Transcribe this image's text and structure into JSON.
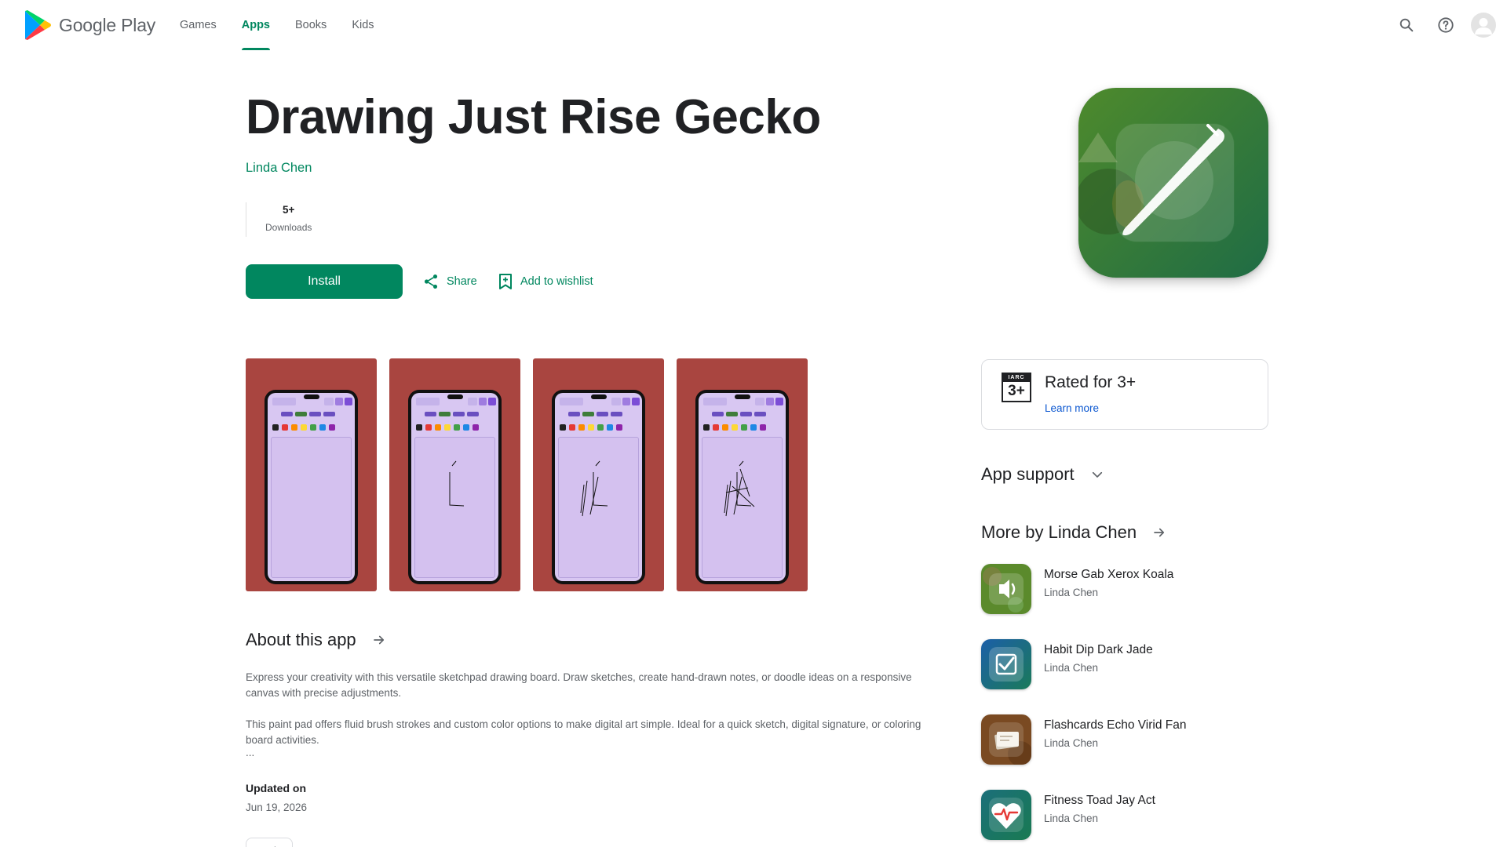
{
  "header": {
    "brand": "Google Play",
    "tabs": [
      {
        "label": "Games",
        "active": false
      },
      {
        "label": "Apps",
        "active": true
      },
      {
        "label": "Books",
        "active": false
      },
      {
        "label": "Kids",
        "active": false
      }
    ],
    "icons": [
      "search-icon",
      "help-icon",
      "account-icon"
    ]
  },
  "app": {
    "title": "Drawing Just Rise Gecko",
    "developer": "Linda Chen",
    "downloads_value": "5+",
    "downloads_label": "Downloads",
    "install_label": "Install",
    "share_label": "Share",
    "wishlist_label": "Add to wishlist"
  },
  "screenshots": [
    {
      "strokes": 0
    },
    {
      "strokes": 2
    },
    {
      "strokes": 5
    },
    {
      "strokes": 8
    }
  ],
  "about": {
    "heading": "About this app",
    "paragraph1": "Express your creativity with this versatile sketchpad drawing board. Draw sketches, create hand-drawn notes, or doodle ideas on a responsive canvas with precise adjustments.",
    "paragraph2": "This paint pad offers fluid brush strokes and custom color options to make digital art simple. Ideal for a quick sketch, digital signature, or coloring board activities.",
    "ellipsis": "...",
    "updated_label": "Updated on",
    "updated_value": "Jun 19, 2026",
    "tag": "Tools"
  },
  "rating": {
    "badge_top": "IARC",
    "badge_value": "3+",
    "title": "Rated for 3+",
    "learn_more": "Learn more"
  },
  "support": {
    "heading": "App support"
  },
  "more_by": {
    "heading": "More by Linda Chen",
    "items": [
      {
        "name": "Morse Gab Xerox Koala",
        "developer": "Linda Chen",
        "icon": "speaker-icon"
      },
      {
        "name": "Habit Dip Dark Jade",
        "developer": "Linda Chen",
        "icon": "checkbox-icon"
      },
      {
        "name": "Flashcards Echo Virid Fan",
        "developer": "Linda Chen",
        "icon": "cards-icon"
      },
      {
        "name": "Fitness Toad Jay Act",
        "developer": "Linda Chen",
        "icon": "heart-pulse-icon"
      }
    ]
  },
  "colors": {
    "accent": "#01875f",
    "link_blue": "#0b57d0",
    "screenshot_bg": "#a94540",
    "canvas": "#d8c7f2"
  }
}
